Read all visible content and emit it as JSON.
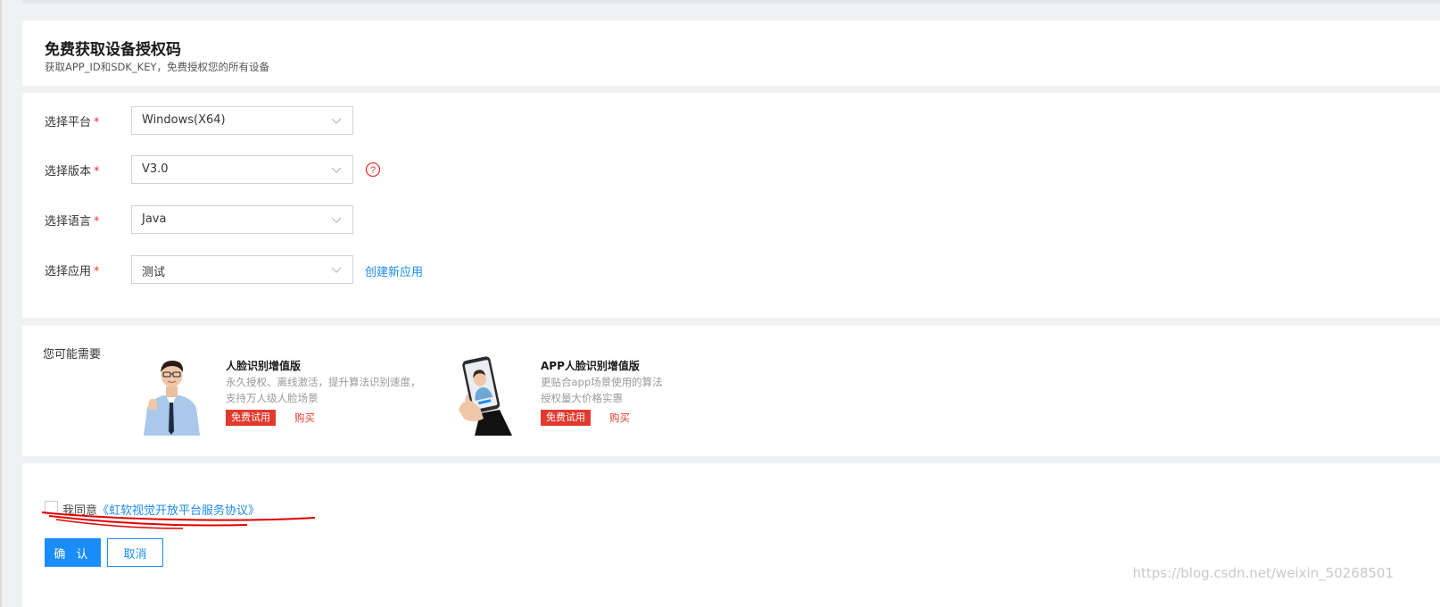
{
  "header": {
    "title": "免费获取设备授权码",
    "subtitle": "获取APP_ID和SDK_KEY，免费授权您的所有设备"
  },
  "form": {
    "required_mark": "*",
    "platform": {
      "label": "选择平台",
      "value": "Windows(X64)"
    },
    "version": {
      "label": "选择版本",
      "value": "V3.0",
      "help_icon": "question-circle-icon"
    },
    "language": {
      "label": "选择语言",
      "value": "Java"
    },
    "app": {
      "label": "选择应用",
      "value": "测试",
      "create_link": "创建新应用"
    }
  },
  "recommend": {
    "title": "您可能需要",
    "products": [
      {
        "name": "人脸识别增值版",
        "desc_line1": "永久授权、离线激活，提升算法识别速度，",
        "desc_line2": "支持万人级人脸场景",
        "trial": "免费试用",
        "buy": "购买",
        "image": "man-in-shirt-thumbs-up"
      },
      {
        "name": "APP人脸识别增值版",
        "desc_line1": "更贴合app场景使用的算法",
        "desc_line2": "授权量大价格实惠",
        "trial": "免费试用",
        "buy": "购买",
        "image": "hand-holding-phone"
      }
    ]
  },
  "agreement": {
    "prefix": "我同意",
    "link": "《虹软视觉开放平台服务协议》",
    "checked": false
  },
  "actions": {
    "confirm": "确 认",
    "cancel": "取消"
  },
  "watermark": "https://blog.csdn.net/weixin_50268501",
  "colors": {
    "link": "#1b8bef",
    "primary": "#1a8dfa",
    "danger": "#e23a2e",
    "annotation": "#e00000"
  }
}
